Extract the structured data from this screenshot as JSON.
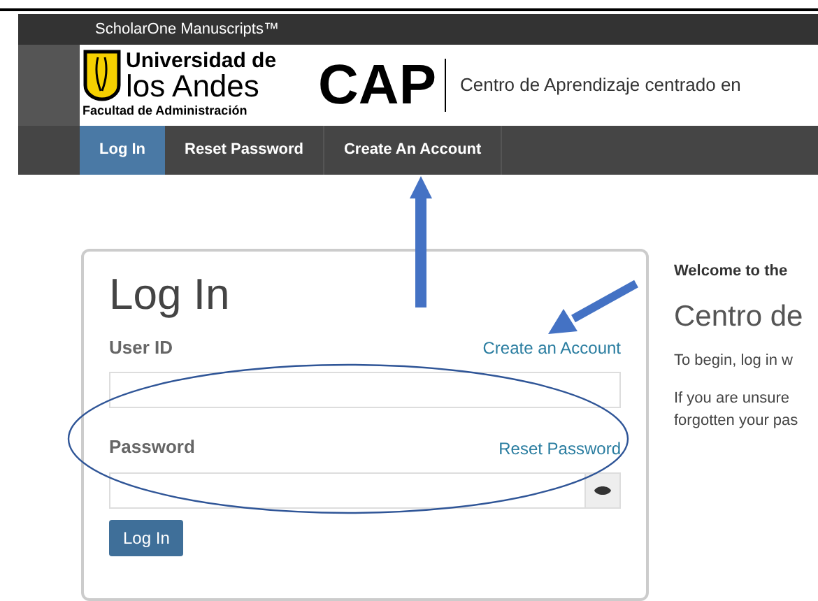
{
  "top_bar": {
    "title": "ScholarOne Manuscripts™"
  },
  "banner": {
    "logo_line_1": "Universidad de",
    "logo_line_2": "los Andes",
    "logo_line_3": "Facultad de Administración",
    "acronym": "CAP",
    "subtitle": "Centro de Aprendizaje centrado en"
  },
  "nav_tabs": [
    {
      "label": "Log In",
      "selected": true
    },
    {
      "label": "Reset Password",
      "selected": false
    },
    {
      "label": "Create An Account",
      "selected": false
    }
  ],
  "login_card": {
    "heading": "Log In",
    "user_id_label": "User ID",
    "create_account_link": "Create an Account",
    "password_label": "Password",
    "reset_password_link": "Reset Password",
    "submit": "Log In"
  },
  "welcome": {
    "title": "Welcome to the",
    "heading": "Centro de",
    "line_1": "To begin, log in w",
    "line_2": "If you are unsure",
    "line_3": "forgotten your pas"
  }
}
